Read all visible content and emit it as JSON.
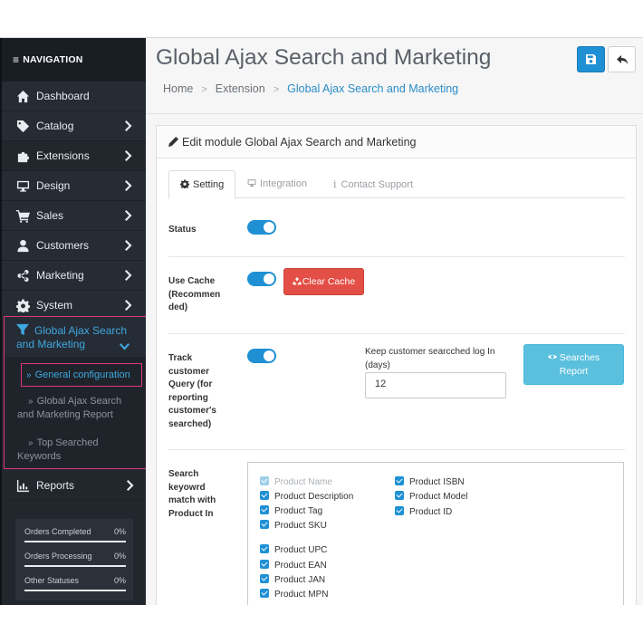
{
  "nav": {
    "heading": "NAVIGATION",
    "items": [
      {
        "label": "Dashboard",
        "icon": "home-icon"
      },
      {
        "label": "Catalog",
        "icon": "tag-icon"
      },
      {
        "label": "Extensions",
        "icon": "puzzle-icon"
      },
      {
        "label": "Design",
        "icon": "monitor-icon"
      },
      {
        "label": "Sales",
        "icon": "cart-icon"
      },
      {
        "label": "Customers",
        "icon": "user-icon"
      },
      {
        "label": "Marketing",
        "icon": "share-icon"
      },
      {
        "label": "System",
        "icon": "gear-icon"
      }
    ],
    "global_ajax": {
      "label": "Global Ajax Search and Marketing",
      "sub_items": [
        "General configuration",
        "Global Ajax Search and Marketing Report",
        "Top Searched Keywords"
      ]
    },
    "reports": {
      "label": "Reports"
    },
    "stats": [
      {
        "label": "Orders Completed",
        "value": "0%"
      },
      {
        "label": "Orders Processing",
        "value": "0%"
      },
      {
        "label": "Other Statuses",
        "value": "0%"
      }
    ]
  },
  "header": {
    "title": "Global Ajax Search and Marketing",
    "breadcrumb": [
      "Home",
      "Extension",
      "Global Ajax Search and Marketing"
    ]
  },
  "panel": {
    "title": "Edit module Global Ajax Search and Marketing",
    "tabs": [
      "Setting",
      "Integration",
      "Contact Support"
    ]
  },
  "form": {
    "status_label": "Status",
    "cache_label_lines": [
      "Use Cache",
      "(Recommen",
      "ded)"
    ],
    "clear_cache_label": "Clear Cache",
    "track_label_lines": [
      "Track",
      "customer",
      "Query (for",
      "reporting",
      "customer's",
      "searched)"
    ],
    "keep_log_label": "Keep customer searcched log In (days)",
    "keep_log_value": "12",
    "searches_report_lines": [
      "Searches",
      "Report"
    ],
    "match_label_lines": [
      "Search",
      "keyowrd",
      "match with",
      "Product In"
    ],
    "match_fields": [
      {
        "label": "Product Name",
        "checked": true,
        "disabled": true
      },
      {
        "label": "Product Description",
        "checked": true
      },
      {
        "label": "Product Tag",
        "checked": true
      },
      {
        "label": "Product SKU",
        "checked": true
      },
      {
        "label": "Product UPC",
        "checked": true
      },
      {
        "label": "Product EAN",
        "checked": true
      },
      {
        "label": "Product JAN",
        "checked": true
      },
      {
        "label": "Product MPN",
        "checked": true
      },
      {
        "label": "Product ISBN",
        "checked": true
      },
      {
        "label": "Product Model",
        "checked": true
      },
      {
        "label": "Product ID",
        "checked": true
      }
    ]
  },
  "colors": {
    "sidebar_bg": "#22272e",
    "accent_blue": "#1f90d4",
    "danger_red": "#e34f46",
    "info_cyan": "#5bc0de",
    "highlight_pink": "#e0357b"
  }
}
